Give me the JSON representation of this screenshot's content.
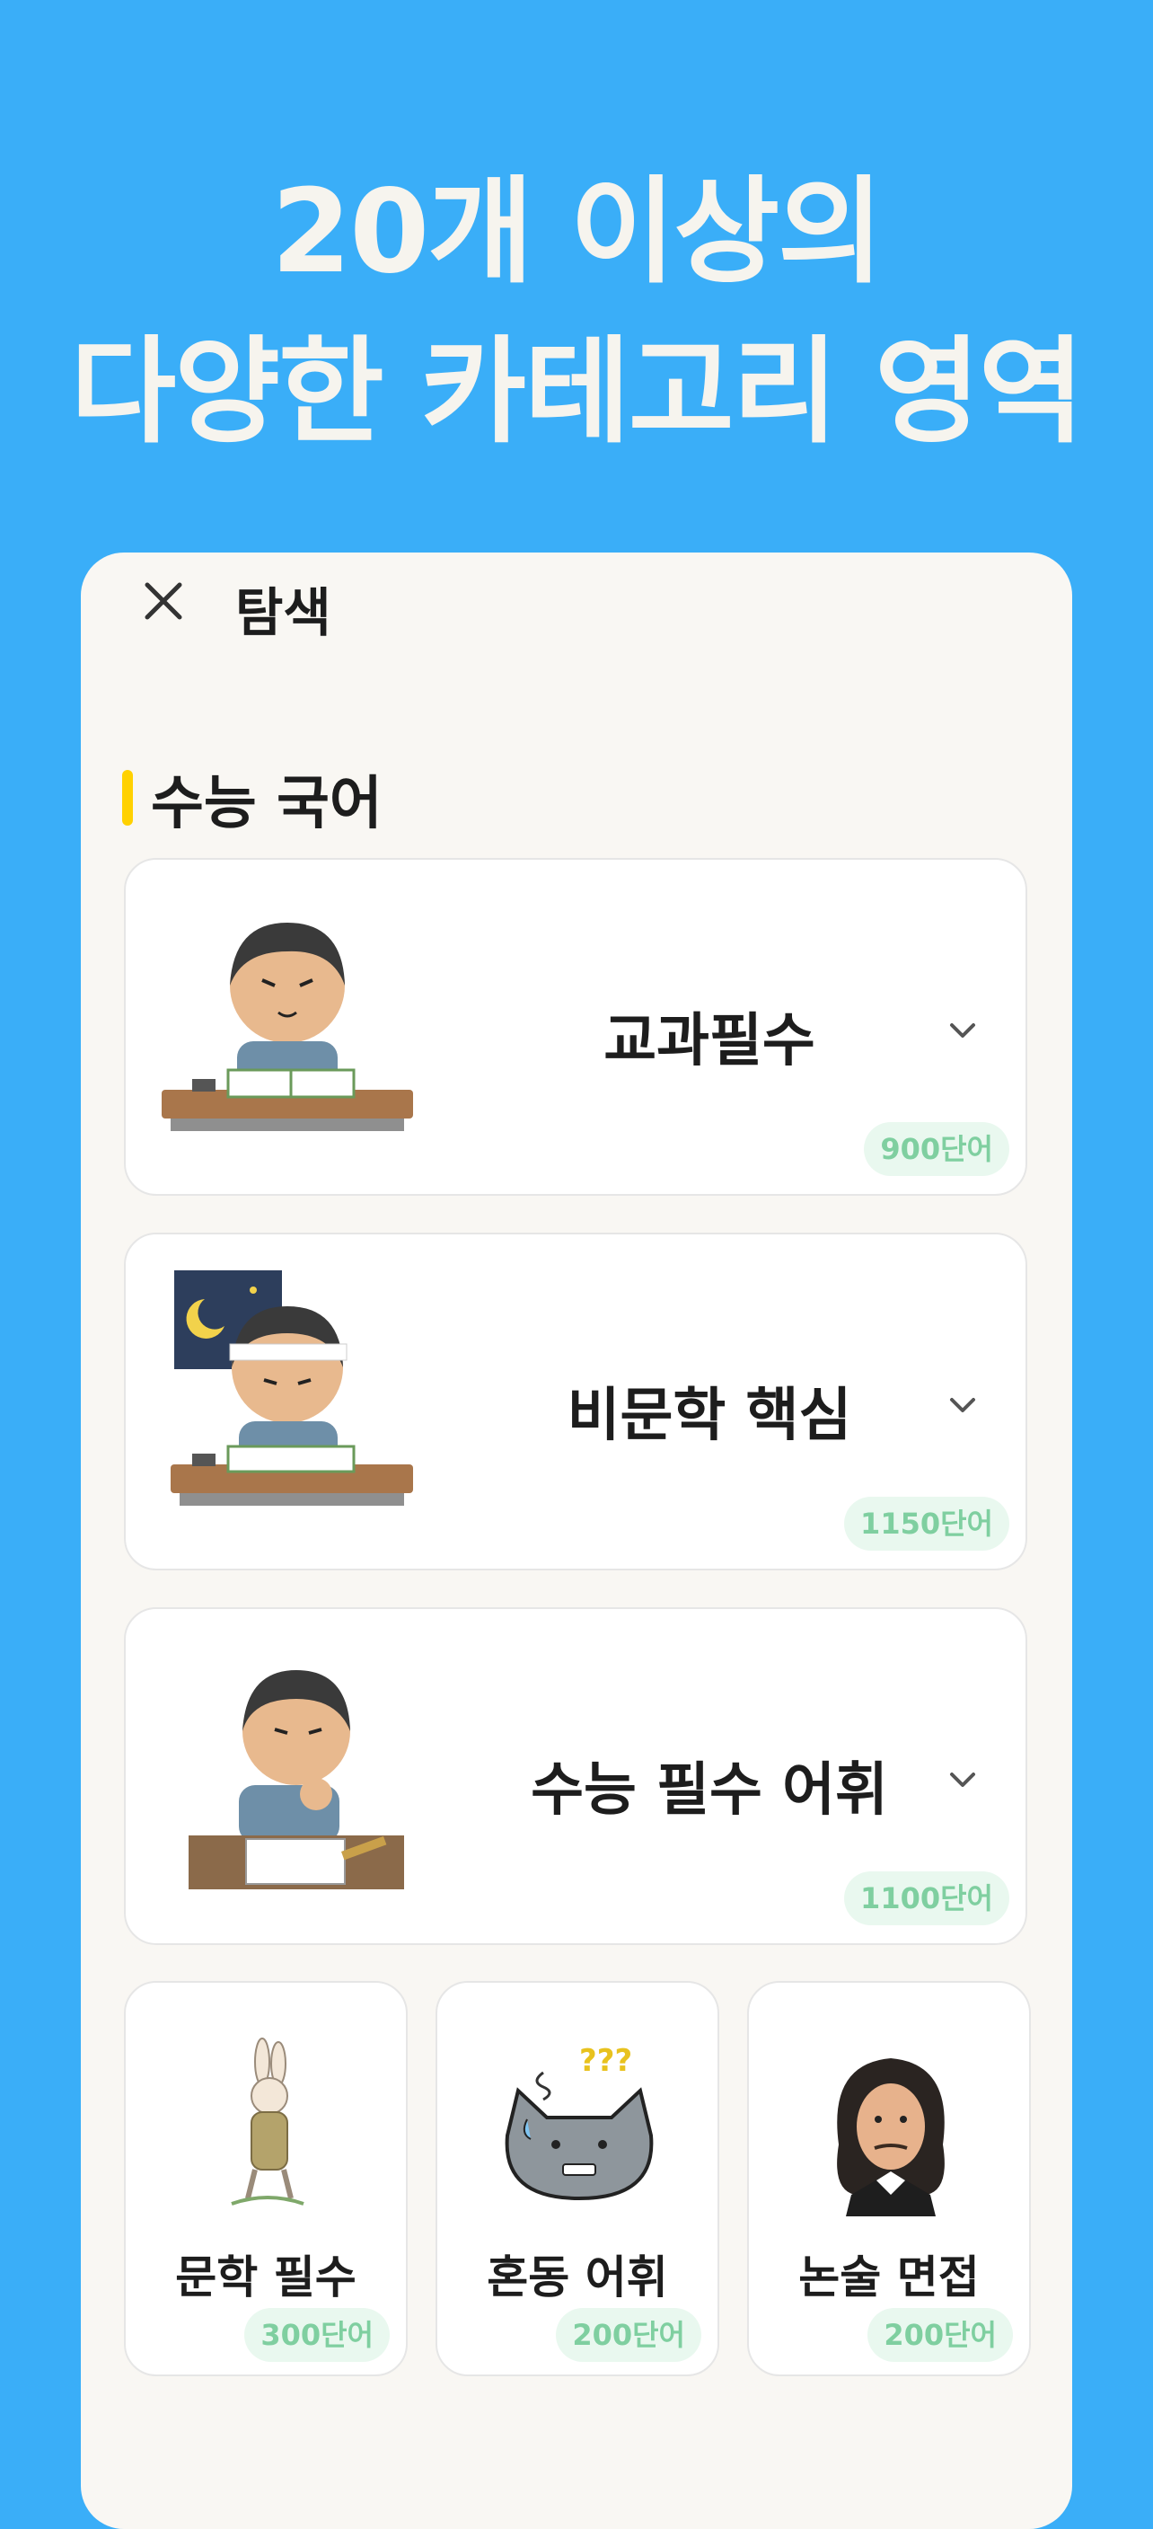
{
  "hero": {
    "line1": "20개 이상의",
    "line2": "다양한 카테고리 영역"
  },
  "topbar": {
    "title": "탐색",
    "close_icon": "close-icon"
  },
  "section": {
    "title": "수능 국어",
    "accent_color": "#FFD100"
  },
  "cards": [
    {
      "title": "교과필수",
      "count": "900단어",
      "icon": "student-writing-illustration"
    },
    {
      "title": "비문학 핵심",
      "count": "1150단어",
      "icon": "student-night-study-illustration"
    },
    {
      "title": "수능 필수 어휘",
      "count": "1100단어",
      "icon": "student-test-illustration"
    }
  ],
  "small_cards": [
    {
      "title": "문학 필수",
      "count": "300단어",
      "icon": "rabbit-illustration"
    },
    {
      "title": "혼동 어휘",
      "count": "200단어",
      "icon": "confused-cat-illustration"
    },
    {
      "title": "논술 면접",
      "count": "200단어",
      "icon": "philosopher-portrait-illustration"
    }
  ],
  "colors": {
    "background": "#3AAEF8",
    "panel": "#F9F7F3",
    "badge_bg": "#E9F8EF",
    "badge_text": "#7FCFA0"
  }
}
